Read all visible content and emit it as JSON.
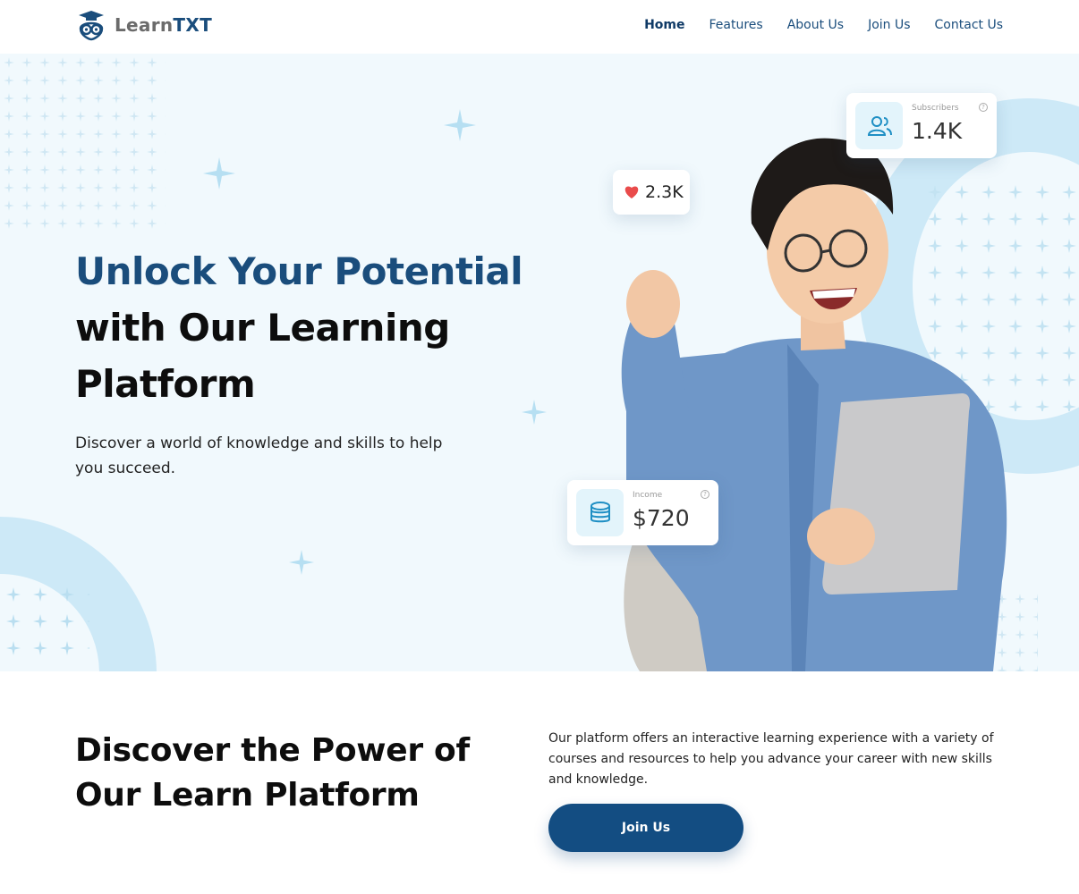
{
  "brand": {
    "name_part1": "Learn",
    "name_part2": "TXT",
    "primary_color": "#1a4d7c",
    "accent_color": "#cde9f7"
  },
  "nav": {
    "items": [
      {
        "label": "Home",
        "active": true
      },
      {
        "label": "Features",
        "active": false
      },
      {
        "label": "About Us",
        "active": false
      },
      {
        "label": "Join Us",
        "active": false
      },
      {
        "label": "Contact Us",
        "active": false
      }
    ]
  },
  "hero": {
    "title_line1": "Unlock Your Potential",
    "title_line2": "with Our Learning",
    "title_line3": "Platform",
    "subtitle": "Discover a world of knowledge and skills to help you succeed."
  },
  "cards": {
    "likes": {
      "value": "2.3K",
      "icon": "heart-icon"
    },
    "subscribers": {
      "label": "Subscribers",
      "value": "1.4K",
      "icon": "users-icon"
    },
    "income": {
      "label": "Income",
      "value": "$720",
      "icon": "coins-icon"
    }
  },
  "section": {
    "title": "Discover the Power of Our Learn Platform",
    "text": "Our platform offers an interactive learning experience with a variety of courses and resources to help you advance your career with new skills and knowledge.",
    "button_label": "Join Us"
  }
}
